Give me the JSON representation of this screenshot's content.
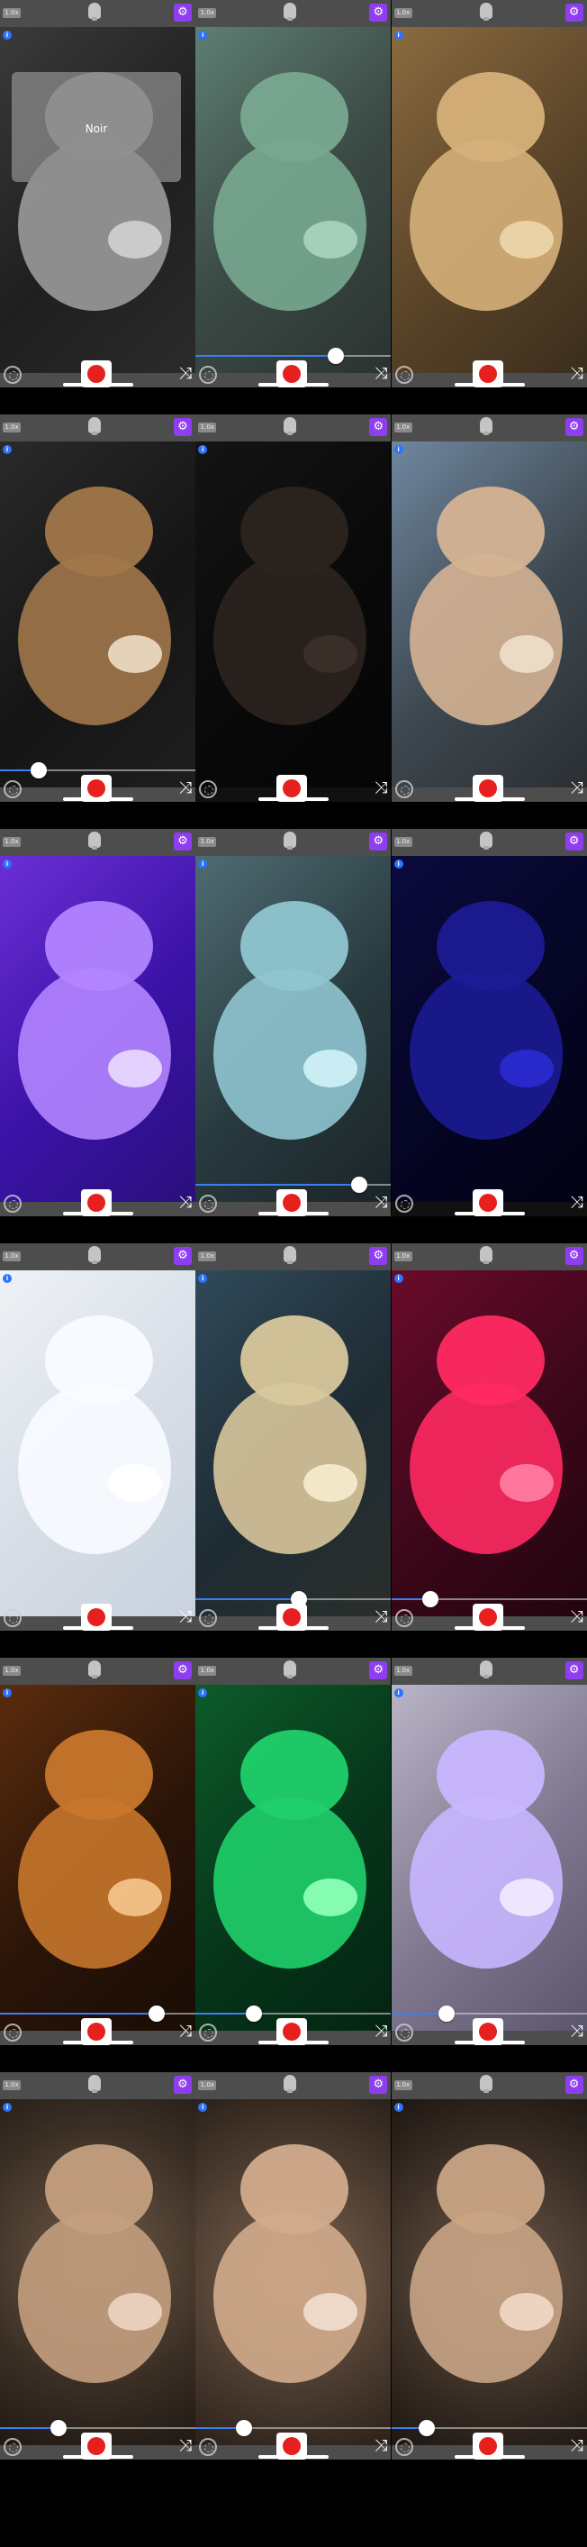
{
  "app": {
    "top_badge": "1.0x",
    "gear_icon": "gear-icon",
    "bulb_icon": "bulb-icon",
    "info_label": "i",
    "shuffle_glyph": "⤨",
    "filter_popup_label": "Noir"
  },
  "colors": {
    "bar": "#4d4d4d",
    "gear": "#8e3df0",
    "record": "#e5201e",
    "slider_fill": "#3b7ff5"
  },
  "rows": [
    {
      "cells": [
        {
          "filter": "Noir",
          "theme": "noir",
          "popup": true,
          "slider": null
        },
        {
          "filter": "",
          "theme": "teal",
          "popup": false,
          "slider": 0.72
        },
        {
          "filter": "",
          "theme": "sepia",
          "popup": false,
          "slider": null
        }
      ]
    },
    {
      "cells": [
        {
          "filter": "",
          "theme": "edges",
          "popup": false,
          "slider": 0.2
        },
        {
          "filter": "",
          "theme": "dark",
          "popup": false,
          "slider": null
        },
        {
          "filter": "",
          "theme": "natural",
          "popup": false,
          "slider": null
        }
      ]
    },
    {
      "cells": [
        {
          "filter": "",
          "theme": "purple",
          "popup": false,
          "slider": null
        },
        {
          "filter": "",
          "theme": "cyan",
          "popup": false,
          "slider": 0.84
        },
        {
          "filter": "",
          "theme": "blue",
          "popup": false,
          "slider": null
        }
      ]
    },
    {
      "cells": [
        {
          "filter": "",
          "theme": "white",
          "popup": false,
          "slider": null
        },
        {
          "filter": "",
          "theme": "solar",
          "popup": false,
          "slider": 0.53
        },
        {
          "filter": "",
          "theme": "red",
          "popup": false,
          "slider": 0.2
        }
      ]
    },
    {
      "cells": [
        {
          "filter": "",
          "theme": "amber",
          "popup": false,
          "slider": 0.8
        },
        {
          "filter": "",
          "theme": "green",
          "popup": false,
          "slider": 0.3
        },
        {
          "filter": "",
          "theme": "lavender",
          "popup": false,
          "slider": 0.28
        }
      ]
    },
    {
      "cells": [
        {
          "filter": "",
          "theme": "kaleido1",
          "popup": false,
          "slider": 0.3
        },
        {
          "filter": "",
          "theme": "kaleido2",
          "popup": false,
          "slider": 0.25
        },
        {
          "filter": "",
          "theme": "kaleido3",
          "popup": false,
          "slider": 0.18
        }
      ]
    }
  ]
}
